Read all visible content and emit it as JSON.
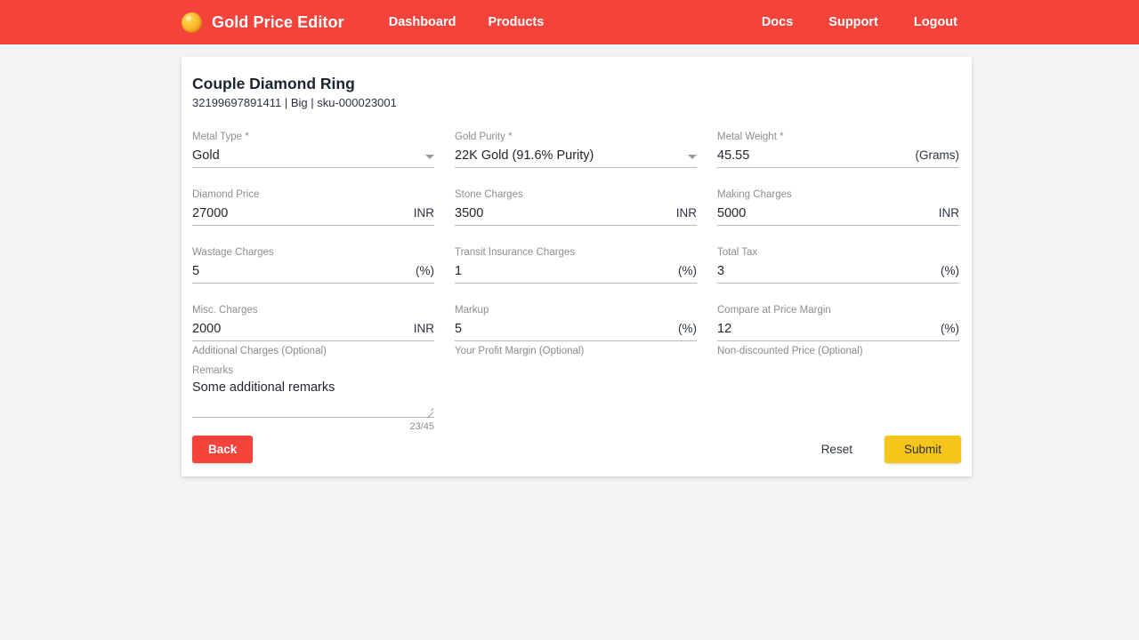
{
  "navbar": {
    "brand": {
      "logo_icon": "gold-nugget-icon",
      "name": "Gold Price Editor"
    },
    "left_links": [
      {
        "label": "Dashboard",
        "name": "nav-link-dashboard"
      },
      {
        "label": "Products",
        "name": "nav-link-products"
      }
    ],
    "right_links": [
      {
        "label": "Docs",
        "name": "nav-link-docs"
      },
      {
        "label": "Support",
        "name": "nav-link-support"
      },
      {
        "label": "Logout",
        "name": "nav-link-logout"
      }
    ],
    "background_color": "#f4433a"
  },
  "card": {
    "title": "Couple Diamond Ring",
    "subtitle": "32199697891411 | Big | sku-000023001"
  },
  "form": {
    "row1": {
      "metal_type": {
        "label": "Metal Type *",
        "value": "Gold",
        "control": "select",
        "caret_icon": "chevron-down-icon"
      },
      "gold_purity": {
        "label": "Gold Purity *",
        "value": "22K Gold (91.6% Purity)",
        "control": "select",
        "caret_icon": "chevron-down-icon"
      },
      "metal_weight": {
        "label": "Metal Weight *",
        "value": "45.55",
        "suffix": "(Grams)"
      }
    },
    "row2": {
      "diamond_price": {
        "label": "Diamond Price",
        "value": "27000",
        "suffix": "INR"
      },
      "stone_charges": {
        "label": "Stone Charges",
        "value": "3500",
        "suffix": "INR"
      },
      "making_charges": {
        "label": "Making Charges",
        "value": "5000",
        "suffix": "INR"
      }
    },
    "row3": {
      "wastage_charges": {
        "label": "Wastage Charges",
        "value": "5",
        "suffix": "(%)"
      },
      "transit_insurance_charges": {
        "label": "Transit Insurance Charges",
        "value": "1",
        "suffix": "(%)"
      },
      "total_tax": {
        "label": "Total Tax",
        "value": "3",
        "suffix": "(%)"
      }
    },
    "row4": {
      "misc_charges": {
        "label": "Misc. Charges",
        "value": "2000",
        "suffix": "INR",
        "hint": "Additional Charges (Optional)"
      },
      "markup": {
        "label": "Markup",
        "value": "5",
        "suffix": "(%)",
        "hint": "Your Profit Margin (Optional)"
      },
      "compare_at_price_margin": {
        "label": "Compare at Price Margin",
        "value": "12",
        "suffix": "(%)",
        "hint": "Non-discounted Price (Optional)"
      }
    },
    "remarks": {
      "label": "Remarks",
      "value": "Some additional remarks",
      "counter": "23/45",
      "resize_icon": "resize-handle-icon"
    }
  },
  "footer": {
    "back_label": "Back",
    "reset_label": "Reset",
    "submit_label": "Submit",
    "back_color": "#f4433a",
    "submit_color": "#f6c51a"
  }
}
